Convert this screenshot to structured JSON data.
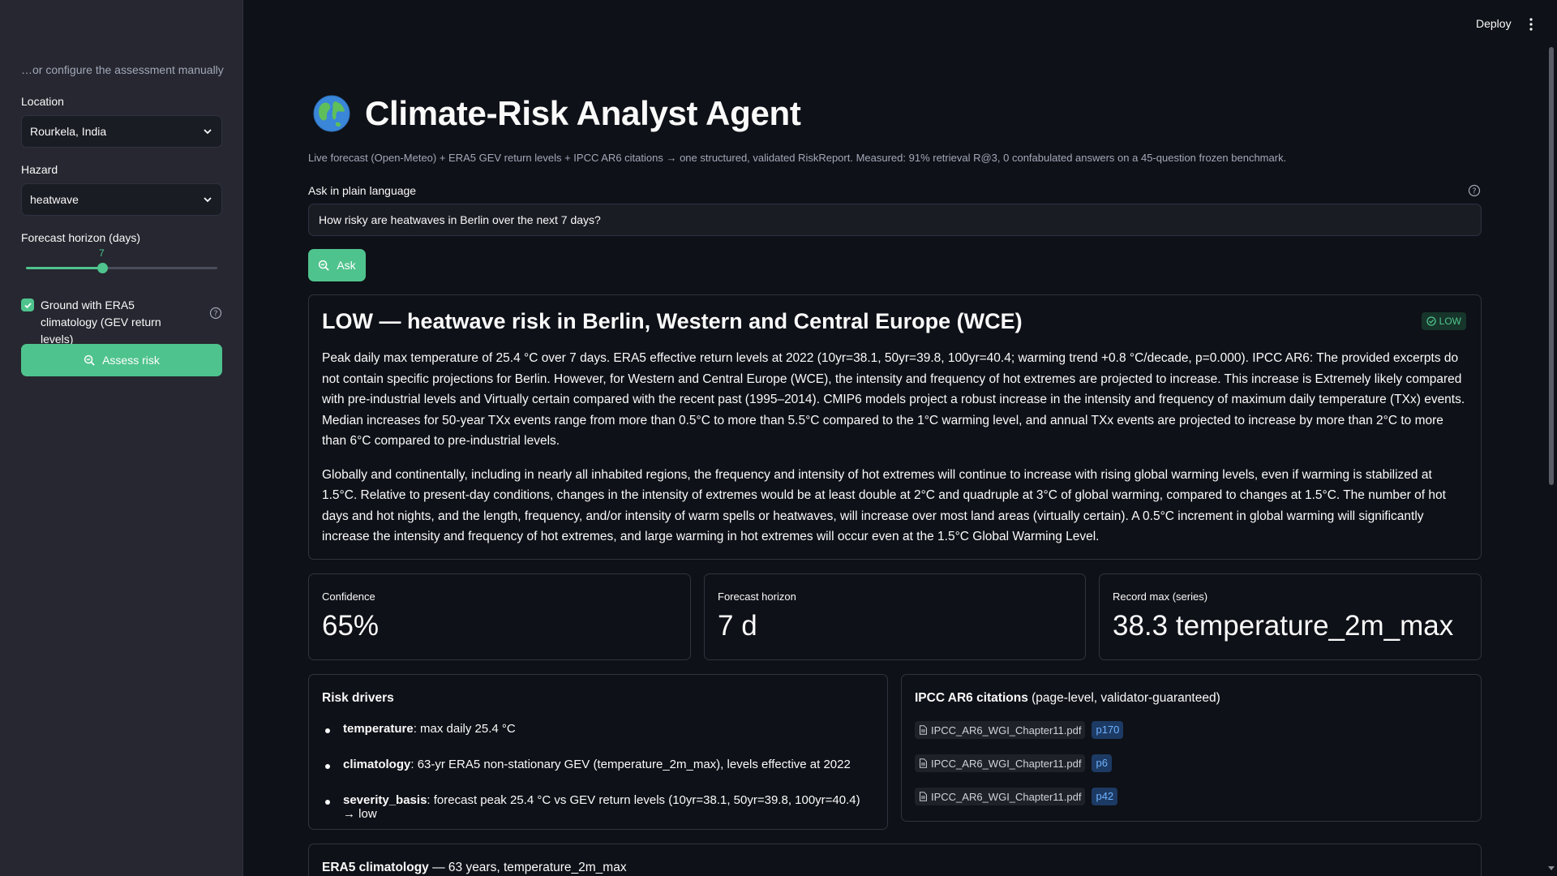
{
  "sidebar": {
    "caption": "…or configure the assessment manually",
    "location": {
      "label": "Location",
      "value": "Rourkela, India"
    },
    "hazard": {
      "label": "Hazard",
      "value": "heatwave"
    },
    "horizon": {
      "label": "Forecast horizon (days)",
      "value": "7",
      "fraction": 0.4
    },
    "checkbox": {
      "label": "Ground with ERA5 climatology (GEV return levels)",
      "checked": true
    },
    "assess_button": "Assess risk"
  },
  "header": {
    "deploy": "Deploy"
  },
  "main": {
    "title": "Climate-Risk Analyst Agent",
    "subtitle": "Live forecast (Open-Meteo) + ERA5 GEV return levels + IPCC AR6 citations → one structured, validated RiskReport. Measured: 91% retrieval R@3, 0 confabulated answers on a 45-question frozen benchmark.",
    "ask_label": "Ask in plain language",
    "ask_value": "How risky are heatwaves in Berlin over the next 7 days?",
    "ask_button": "Ask"
  },
  "report": {
    "title": "LOW — heatwave risk in Berlin, Western and Central Europe (WCE)",
    "badge": "LOW",
    "paragraph1": "Peak daily max temperature of 25.4 °C over 7 days. ERA5 effective return levels at 2022 (10yr=38.1, 50yr=39.8, 100yr=40.4; warming trend +0.8 °C/decade, p=0.000). IPCC AR6: The provided excerpts do not contain specific projections for Berlin. However, for Western and Central Europe (WCE), the intensity and frequency of hot extremes are projected to increase. This increase is Extremely likely compared with pre-industrial levels and Virtually certain compared with the recent past (1995–2014). CMIP6 models project a robust increase in the intensity and frequency of maximum daily temperature (TXx) events. Median increases for 50-year TXx events range from more than 0.5°C to more than 5.5°C compared to the 1°C warming level, and annual TXx events are projected to increase by more than 2°C to more than 6°C compared to pre-industrial levels.",
    "paragraph2": "Globally and continentally, including in nearly all inhabited regions, the frequency and intensity of hot extremes will continue to increase with rising global warming levels, even if warming is stabilized at 1.5°C. Relative to present-day conditions, changes in the intensity of extremes would be at least double at 2°C and quadruple at 3°C of global warming, compared to changes at 1.5°C. The number of hot days and hot nights, and the length, frequency, and/or intensity of warm spells or heatwaves, will increase over most land areas (virtually certain). A 0.5°C increment in global warming will significantly increase the intensity and frequency of hot extremes, and large warming in hot extremes will occur even at the 1.5°C Global Warming Level."
  },
  "metrics": [
    {
      "label": "Confidence",
      "value": "65%"
    },
    {
      "label": "Forecast horizon",
      "value": "7 d"
    },
    {
      "label": "Record max (series)",
      "value": "38.3 temperature_2m_max"
    }
  ],
  "drivers": {
    "title": "Risk drivers",
    "items": [
      {
        "key": "temperature",
        "text": ": max daily 25.4 °C"
      },
      {
        "key": "climatology",
        "text": ": 63-yr ERA5 non-stationary GEV (temperature_2m_max), levels effective at 2022"
      },
      {
        "key": "severity_basis",
        "text": ": forecast peak 25.4 °C vs GEV return levels (10yr=38.1, 50yr=39.8, 100yr=40.4) → low"
      }
    ]
  },
  "citations": {
    "title_bold": "IPCC AR6 citations",
    "title_rest": " (page-level, validator-guaranteed)",
    "items": [
      {
        "file": "IPCC_AR6_WGI_Chapter11.pdf",
        "page": "p170"
      },
      {
        "file": "IPCC_AR6_WGI_Chapter11.pdf",
        "page": "p6"
      },
      {
        "file": "IPCC_AR6_WGI_Chapter11.pdf",
        "page": "p42"
      }
    ]
  },
  "era5": {
    "title_bold": "ERA5 climatology",
    "title_rest": " — 63 years, temperature_2m_max"
  },
  "colors": {
    "accent": "#4fc38d",
    "background": "#0e1117",
    "sidebar": "#262730",
    "page_badge": "#1c3a63"
  }
}
